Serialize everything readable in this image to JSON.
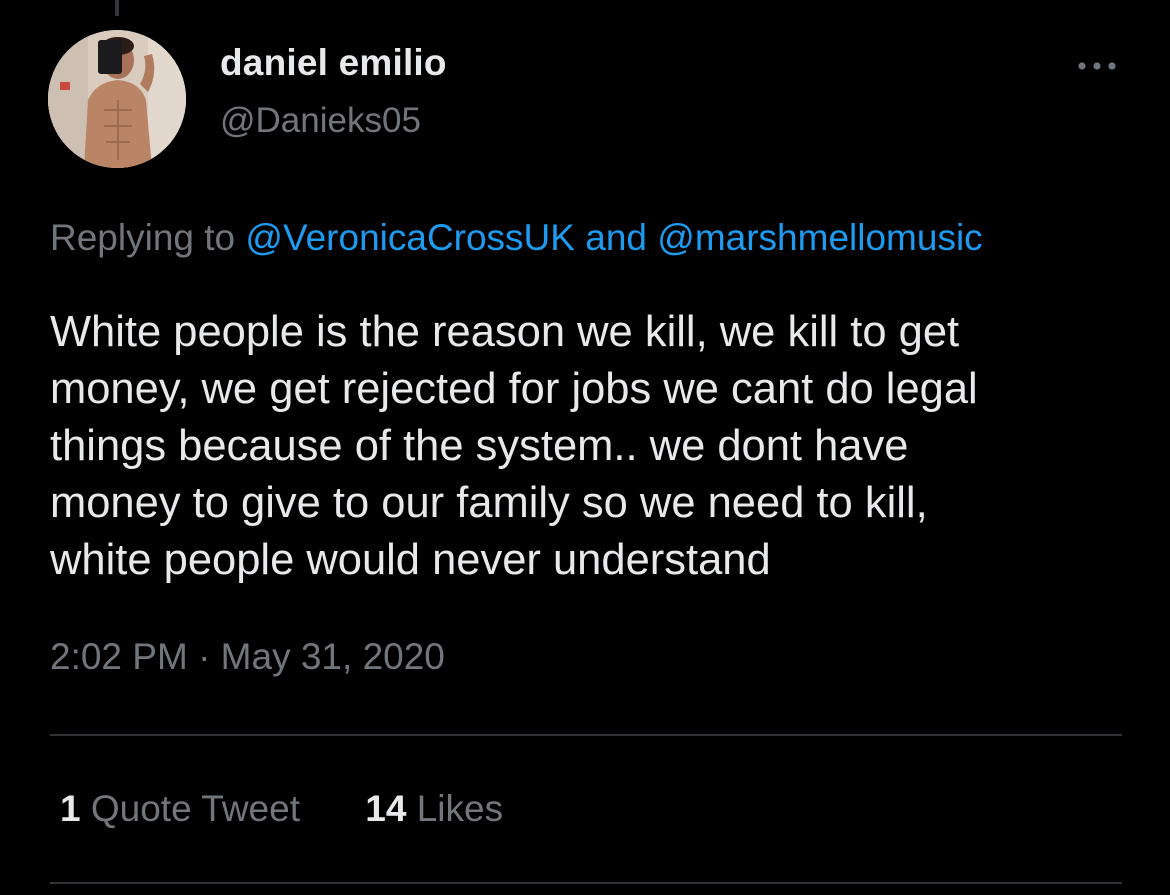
{
  "author": {
    "display_name": "daniel emilio",
    "handle": "@Danieks05"
  },
  "reply_context": {
    "prefix": "Replying to",
    "mention_1": "@VeronicaCrossUK",
    "joiner": "and",
    "mention_2": "@marshmellomusic"
  },
  "tweet": {
    "lines": [
      "White people is the reason we kill, we kill to get",
      "money, we get rejected for jobs we cant do legal",
      "things because of the system.. we dont have",
      "money to give to our family so we need to kill,",
      "white people would never understand"
    ],
    "timestamp": "2:02 PM · May 31, 2020"
  },
  "stats": {
    "quote_count": "1",
    "quote_label": "Quote Tweet",
    "like_count": "14",
    "like_label": "Likes"
  },
  "icons": {
    "more": "more-horizontal-icon"
  },
  "colors": {
    "background": "#000000",
    "primary_text": "#e7e9ea",
    "secondary_text": "#71767b",
    "link": "#1d9bf0",
    "divider": "#2f3336"
  }
}
